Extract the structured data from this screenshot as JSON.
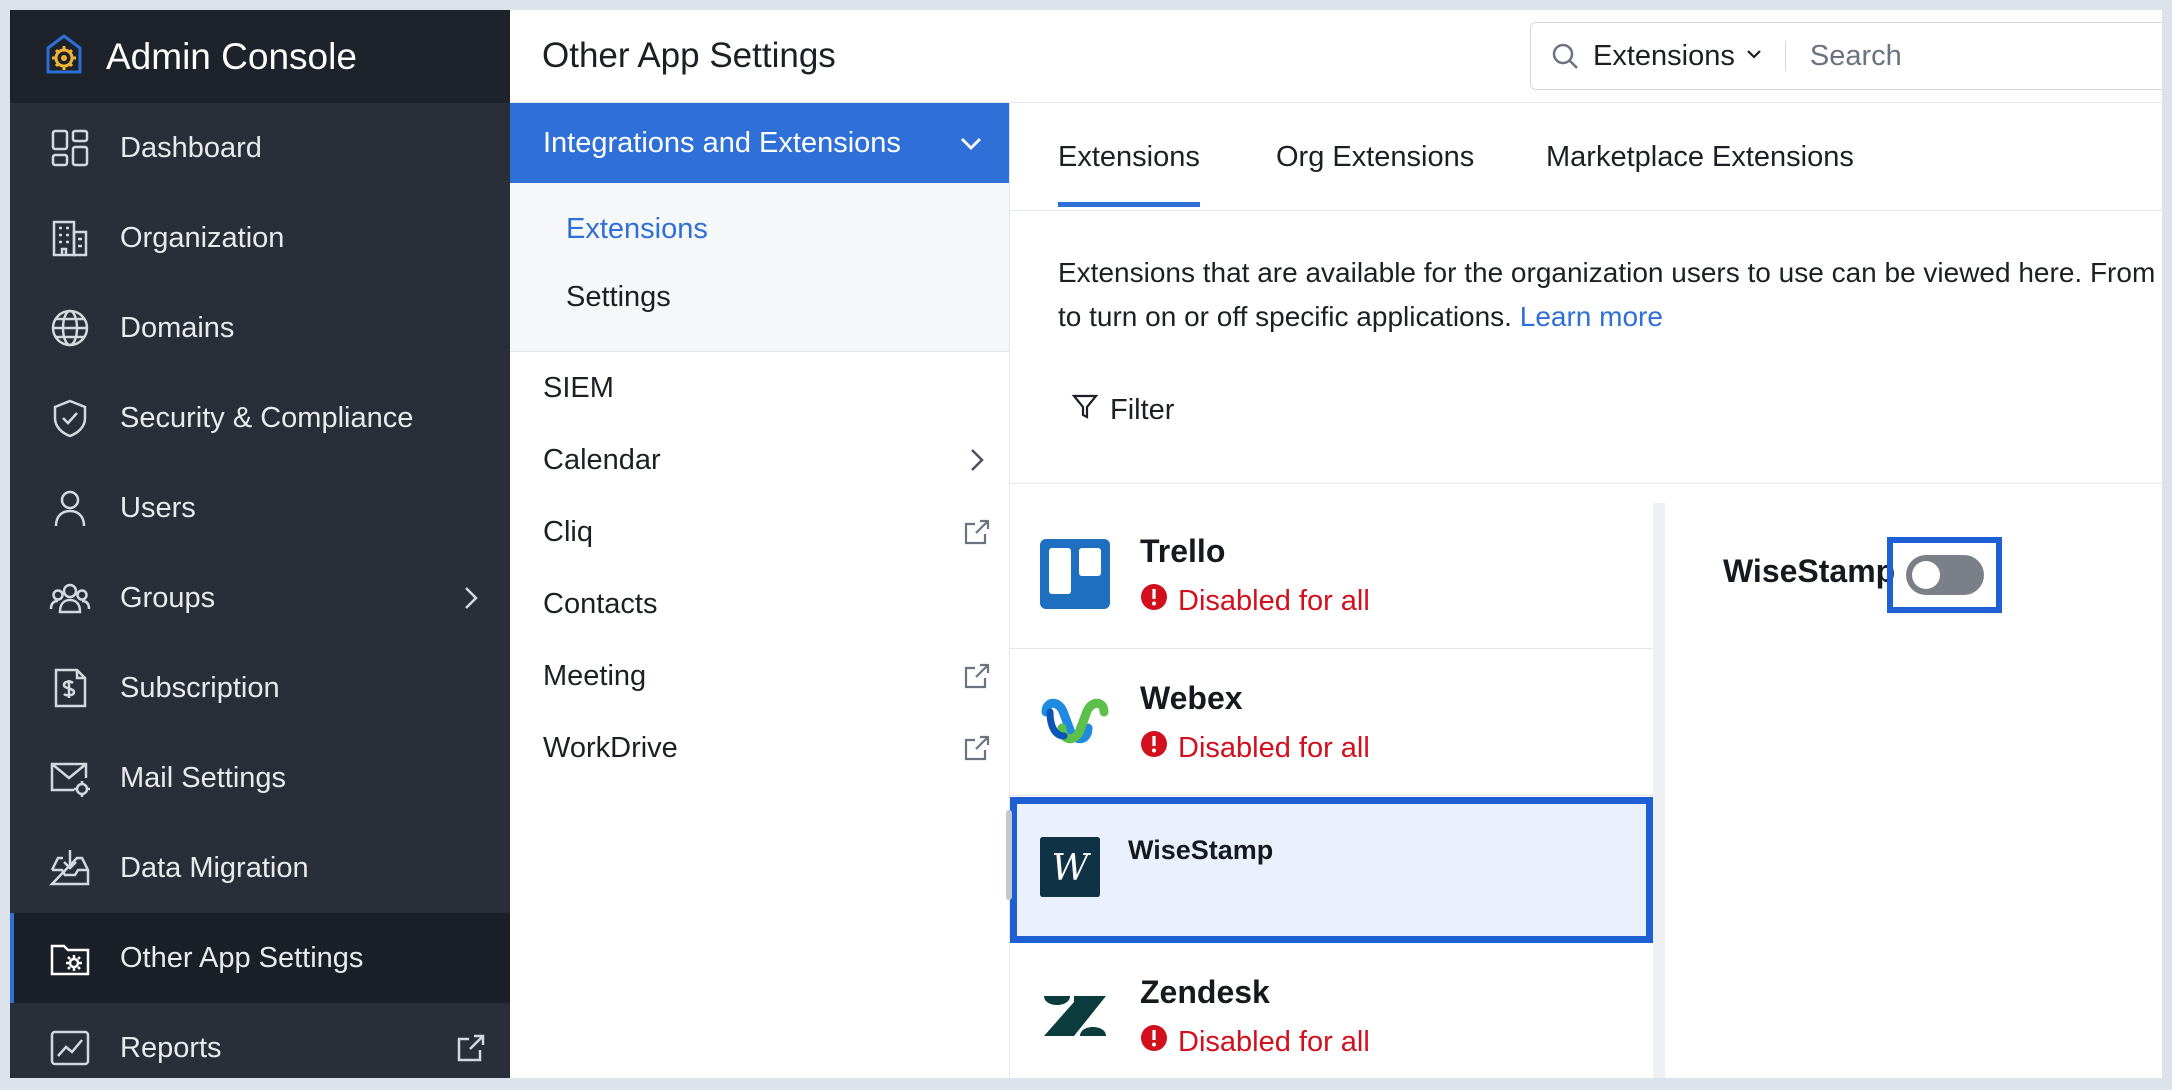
{
  "brand": {
    "title": "Admin Console"
  },
  "sidebar": {
    "items": [
      {
        "label": "Dashboard",
        "icon": "dashboard-icon"
      },
      {
        "label": "Organization",
        "icon": "building-icon"
      },
      {
        "label": "Domains",
        "icon": "globe-icon"
      },
      {
        "label": "Security & Compliance",
        "icon": "shield-icon"
      },
      {
        "label": "Users",
        "icon": "user-icon"
      },
      {
        "label": "Groups",
        "icon": "group-icon"
      },
      {
        "label": "Subscription",
        "icon": "billing-icon"
      },
      {
        "label": "Mail Settings",
        "icon": "mail-settings-icon"
      },
      {
        "label": "Data Migration",
        "icon": "inbox-download-icon"
      },
      {
        "label": "Other App Settings",
        "icon": "folder-gear-icon",
        "active": true
      },
      {
        "label": "Reports",
        "icon": "chart-icon"
      }
    ]
  },
  "header": {
    "title": "Other App Settings",
    "search": {
      "scope": "Extensions",
      "placeholder": "Search"
    }
  },
  "submenu": {
    "group": {
      "label": "Integrations and Extensions",
      "children": [
        "Extensions",
        "Settings"
      ]
    },
    "items": [
      {
        "label": "SIEM"
      },
      {
        "label": "Calendar"
      },
      {
        "label": "Cliq"
      },
      {
        "label": "Contacts"
      },
      {
        "label": "Meeting"
      },
      {
        "label": "WorkDrive"
      }
    ]
  },
  "main": {
    "tabs": [
      "Extensions",
      "Org Extensions",
      "Marketplace Extensions"
    ],
    "description_line1": "Extensions that are available for the organization users to use can be viewed here. From",
    "description_line2": "to turn on or off specific applications.",
    "learn_more": "Learn more",
    "filter_label": "Filter",
    "extensions": [
      {
        "name": "Trello",
        "status": "Disabled for all"
      },
      {
        "name": "Webex",
        "status": "Disabled for all"
      },
      {
        "name": "WiseStamp",
        "status": ""
      },
      {
        "name": "Zendesk",
        "status": "Disabled for all"
      }
    ],
    "detail": {
      "title": "WiseStamp",
      "toggle_on": false
    }
  },
  "colors": {
    "accent": "#2f6fd8",
    "sidebar_bg": "#2a2e38",
    "status_red": "#d10f1d",
    "highlight_border": "#1e5fd3"
  }
}
